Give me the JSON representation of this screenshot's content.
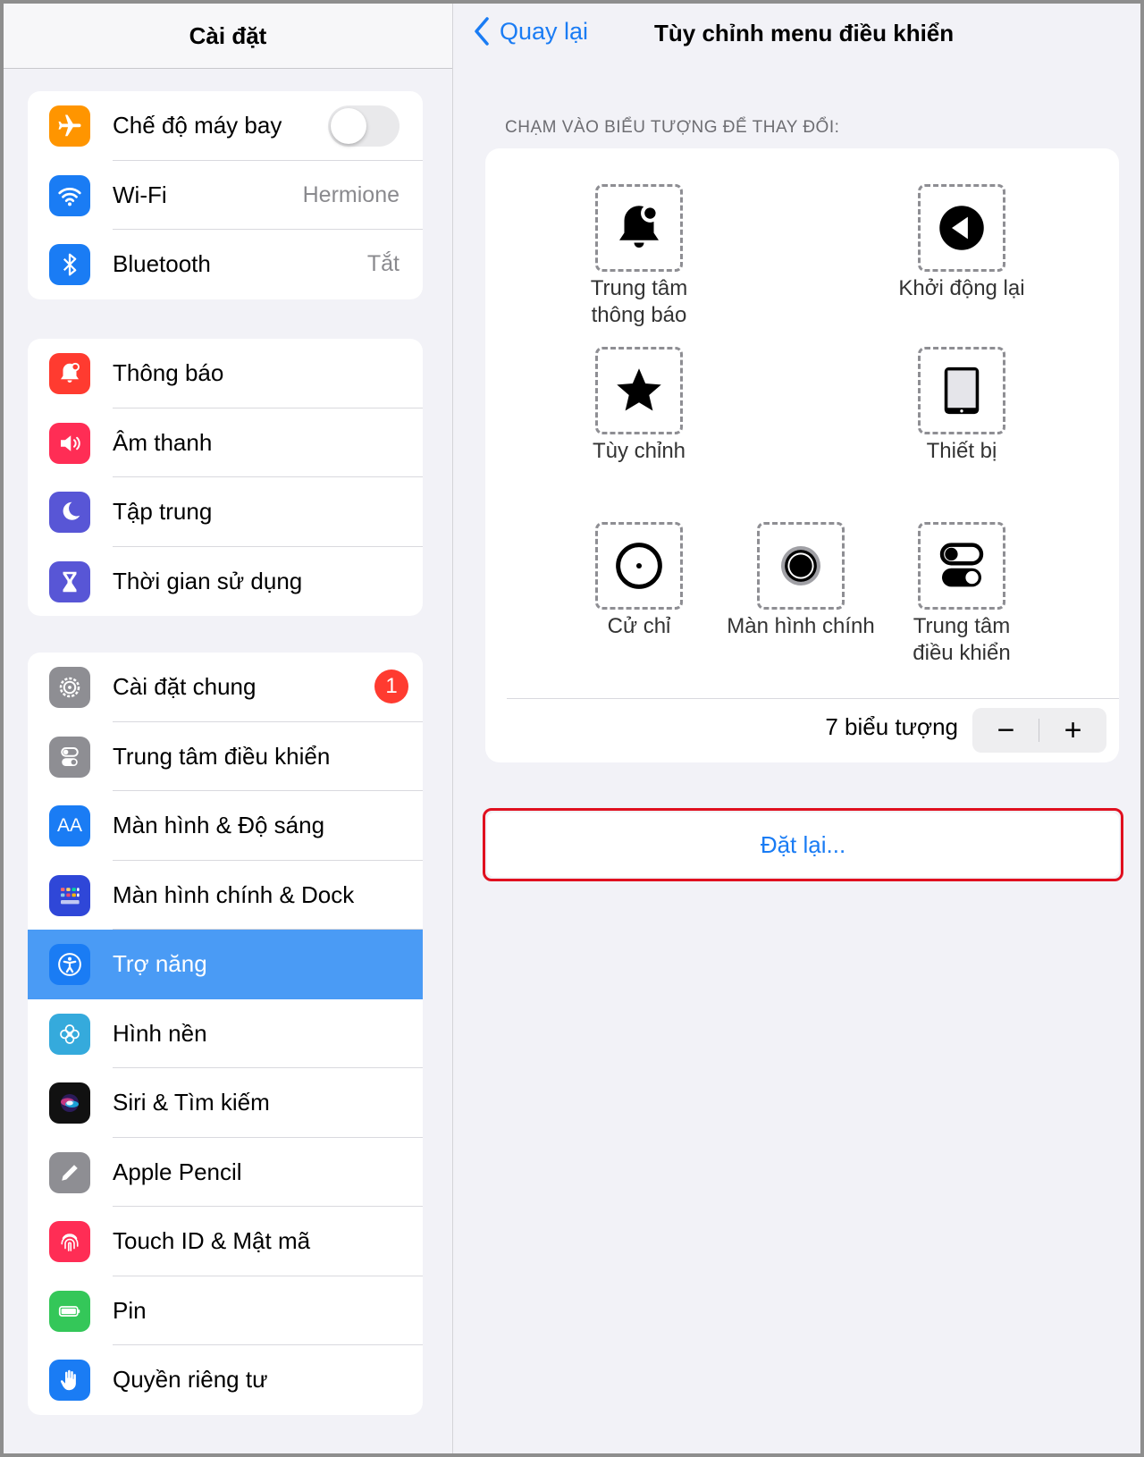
{
  "sidebar": {
    "title": "Cài đặt",
    "group1": [
      {
        "label": "Chế độ máy bay",
        "icon": "airplane-icon",
        "color": "#ff9500",
        "toggle": false
      },
      {
        "label": "Wi-Fi",
        "icon": "wifi-icon",
        "color": "#1a7cf4",
        "value": "Hermione"
      },
      {
        "label": "Bluetooth",
        "icon": "bluetooth-icon",
        "color": "#1a7cf4",
        "value": "Tắt"
      }
    ],
    "group2": [
      {
        "label": "Thông báo",
        "icon": "notification-icon",
        "color": "#ff3b30"
      },
      {
        "label": "Âm thanh",
        "icon": "speaker-icon",
        "color": "#ff2d55"
      },
      {
        "label": "Tập trung",
        "icon": "moon-icon",
        "color": "#5856d6"
      },
      {
        "label": "Thời gian sử dụng",
        "icon": "hourglass-icon",
        "color": "#5856d6"
      }
    ],
    "group3": [
      {
        "label": "Cài đặt chung",
        "icon": "gear-icon",
        "color": "#8e8e93",
        "badge": "1"
      },
      {
        "label": "Trung tâm điều khiển",
        "icon": "control-center-icon",
        "color": "#8e8e93"
      },
      {
        "label": "Màn hình & Độ sáng",
        "icon": "display-icon",
        "color": "#1a7cf4",
        "glyph": "AA"
      },
      {
        "label": "Màn hình chính & Dock",
        "icon": "home-screen-icon",
        "color": "#2f47d8"
      },
      {
        "label": "Trợ năng",
        "icon": "accessibility-icon",
        "color": "#1a7cf4",
        "selected": true
      },
      {
        "label": "Hình nền",
        "icon": "wallpaper-icon",
        "color": "#35aadc"
      },
      {
        "label": "Siri & Tìm kiếm",
        "icon": "siri-icon",
        "color": "#222"
      },
      {
        "label": "Apple Pencil",
        "icon": "pencil-icon",
        "color": "#8e8e93"
      },
      {
        "label": "Touch ID & Mật mã",
        "icon": "fingerprint-icon",
        "color": "#ff2d55"
      },
      {
        "label": "Pin",
        "icon": "battery-icon",
        "color": "#34c759"
      },
      {
        "label": "Quyền riêng tư",
        "icon": "hand-icon",
        "color": "#1a7cf4"
      }
    ]
  },
  "detail": {
    "back_label": "Quay lại",
    "title": "Tùy chỉnh menu điều khiển",
    "section_header": "CHẠM VÀO BIỂU TƯỢNG ĐỂ THAY ĐỔI:",
    "slots": [
      {
        "label": "Trung tâm thông báo",
        "icon": "notification-center-icon"
      },
      {
        "label": "Khởi động lại",
        "icon": "restart-icon"
      },
      {
        "label": "Tùy chỉnh",
        "icon": "star-icon"
      },
      {
        "label": "Thiết bị",
        "icon": "device-icon"
      },
      {
        "label": "Cử chỉ",
        "icon": "gesture-icon"
      },
      {
        "label": "Màn hình chính",
        "icon": "home-button-icon"
      },
      {
        "label": "Trung tâm điều khiển",
        "icon": "control-center-toggle-icon"
      }
    ],
    "count_label": "7 biểu tượng",
    "minus": "−",
    "plus": "+",
    "reset_label": "Đặt lại..."
  }
}
